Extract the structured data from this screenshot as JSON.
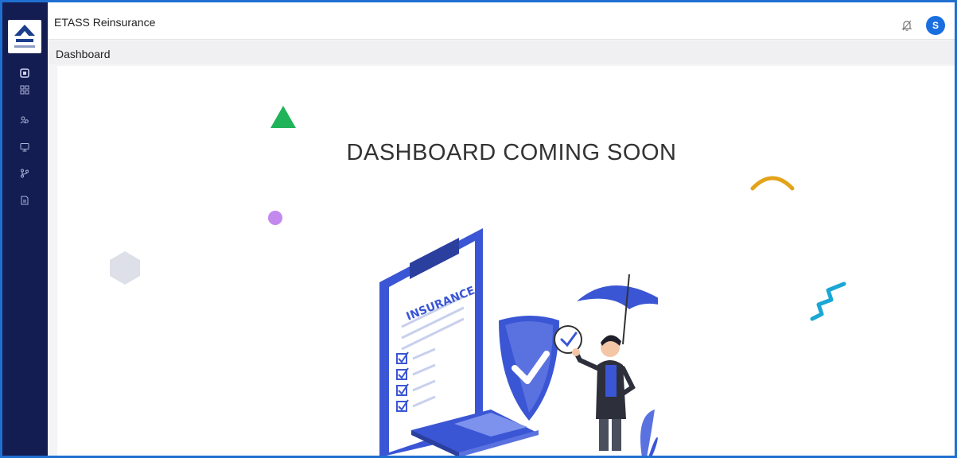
{
  "app": {
    "title": "ETASS Reinsurance"
  },
  "user": {
    "avatar_initial": "S"
  },
  "breadcrumb": {
    "current": "Dashboard"
  },
  "sidebar": {
    "items": [
      {
        "icon": "dashboard-icon"
      },
      {
        "icon": "grid-icon"
      },
      {
        "icon": "users-icon"
      },
      {
        "icon": "monitor-icon"
      },
      {
        "icon": "branch-icon"
      },
      {
        "icon": "document-icon"
      }
    ]
  },
  "main": {
    "headline": "DASHBOARD COMING SOON",
    "illustration_label": "INSURANCE"
  },
  "colors": {
    "sidebar": "#141d52",
    "accent": "#1a6fe0",
    "illustration_blue": "#3b56d4",
    "triangle": "#21b35a",
    "arc": "#e3a31a",
    "zigzag": "#1aa7d6"
  }
}
